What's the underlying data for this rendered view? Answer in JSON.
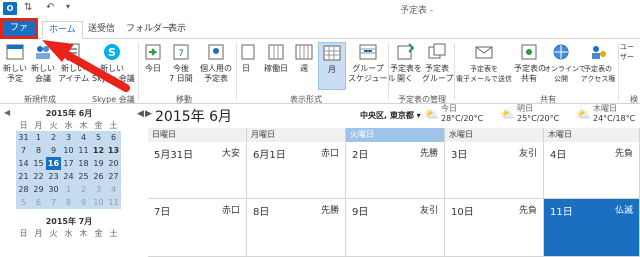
{
  "titlebar": {
    "title": "予定表 -"
  },
  "tabs": [
    {
      "label": "ファイル"
    },
    {
      "label": "ホーム"
    },
    {
      "label": "送受信"
    },
    {
      "label": "フォルダー"
    },
    {
      "label": "表示"
    }
  ],
  "ribbon": {
    "new_appointment": "新しい\n予定",
    "new_meeting": "新しい\n会議",
    "new_items": "新しい\nアイテム",
    "new_skype": "新しい\nSkype 会議",
    "today": "今日",
    "next7": "今後\n7 日間",
    "personal_schedule": "個人用の\n予定表",
    "day": "日",
    "workweek": "稼働日",
    "week": "週",
    "month": "月",
    "group_schedule": "グループ\nスケジュール",
    "open_calendar": "予定表を\n開く",
    "calendar_groups": "予定表\nグループ",
    "email_calendar": "予定表を\n電子メールで送信",
    "share_calendar": "予定表の\n共有",
    "publish_online": "オンラインで\n公開",
    "access_perm": "予定表の\nアクセス権",
    "user": "ユーザー",
    "groups": {
      "new": "新規作成",
      "skype": "Skype 会議",
      "move": "移動",
      "view": "表示形式",
      "manage": "予定表の管理",
      "share": "共有",
      "find": "検"
    }
  },
  "mini_calendars": [
    {
      "header": "2015年 6月",
      "weekdays": [
        "日",
        "月",
        "火",
        "水",
        "木",
        "金",
        "土"
      ],
      "rows": [
        [
          "31",
          "1",
          "2",
          "3",
          "4",
          "5",
          "6"
        ],
        [
          "7",
          "8",
          "9",
          "10",
          "11",
          "12",
          "13"
        ],
        [
          "14",
          "15",
          "16",
          "17",
          "18",
          "19",
          "20"
        ],
        [
          "21",
          "22",
          "23",
          "24",
          "25",
          "26",
          "27"
        ],
        [
          "28",
          "29",
          "30",
          "1",
          "2",
          "3",
          "4"
        ],
        [
          "5",
          "6",
          "7",
          "8",
          "9",
          "10",
          "11"
        ]
      ]
    },
    {
      "header": "2015年 7月",
      "weekdays": [
        "日",
        "月",
        "火",
        "水",
        "木",
        "金",
        "土"
      ]
    }
  ],
  "calendar": {
    "title": "2015年 6月",
    "location": "中央区, 東京都 ▾",
    "weather": [
      {
        "day": "今日",
        "temp": "28°C/20°C"
      },
      {
        "day": "明日",
        "temp": "25°C/20°C"
      },
      {
        "day": "木曜日",
        "temp": "24°C/18°C"
      }
    ],
    "day_names": [
      "日曜日",
      "月曜日",
      "火曜日",
      "水曜日",
      "木曜日"
    ],
    "weeks": [
      [
        {
          "date": "5月31日",
          "rokuyo": "大安"
        },
        {
          "date": "6月1日",
          "rokuyo": "赤口"
        },
        {
          "date": "2日",
          "rokuyo": "先勝"
        },
        {
          "date": "3日",
          "rokuyo": "友引"
        },
        {
          "date": "4日",
          "rokuyo": "先負"
        }
      ],
      [
        {
          "date": "7日",
          "rokuyo": "赤口"
        },
        {
          "date": "8日",
          "rokuyo": "先勝"
        },
        {
          "date": "9日",
          "rokuyo": "友引"
        },
        {
          "date": "10日",
          "rokuyo": "先負"
        },
        {
          "date": "11日",
          "rokuyo": "仏滅"
        }
      ]
    ]
  },
  "colors": {
    "accent": "#1a6fc1",
    "highlight": "#e1261c",
    "selected_day": "#1a6fc1",
    "today_header": "#9ec4ea"
  }
}
